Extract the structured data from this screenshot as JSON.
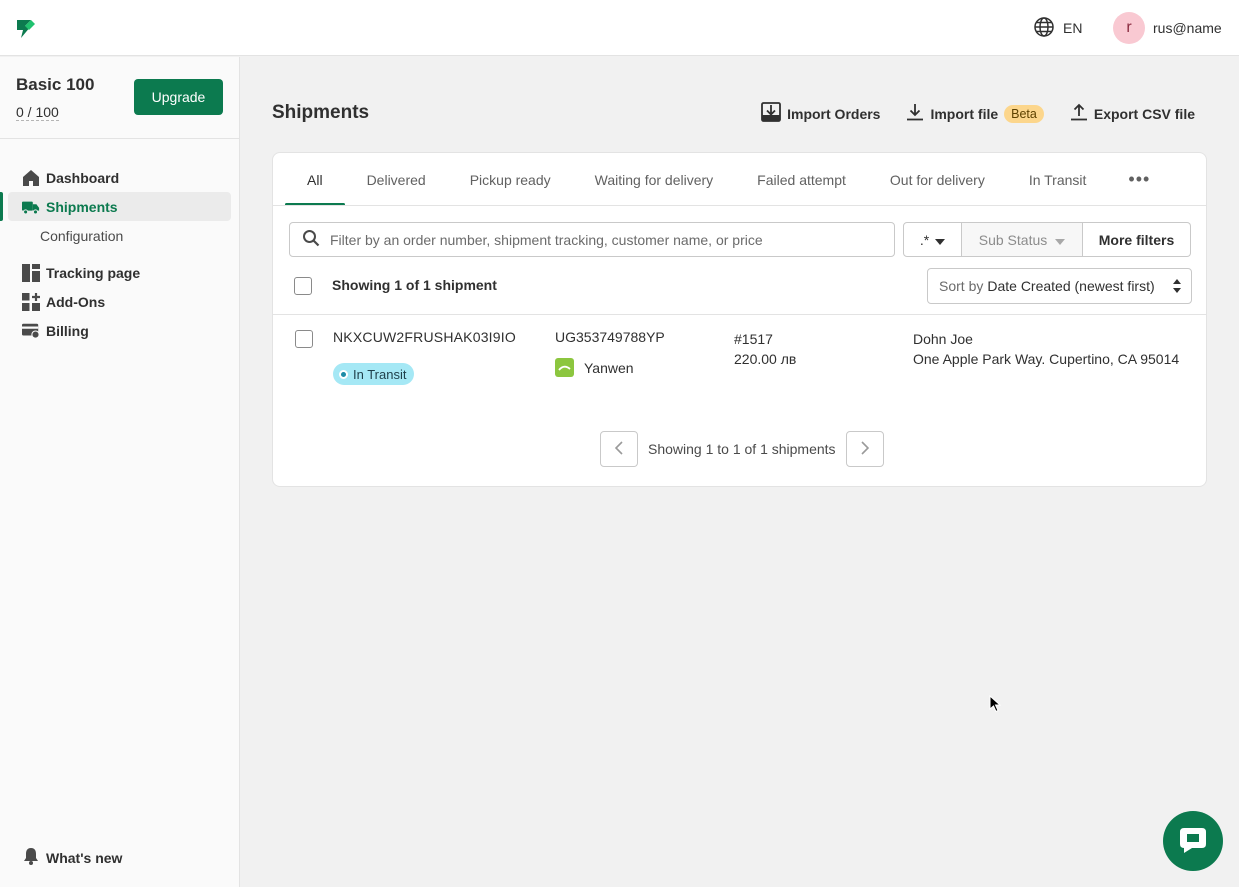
{
  "topbar": {
    "logo_icon": "brand-logo-icon",
    "language": "EN",
    "user_initial": "r",
    "user_name": "rus@name"
  },
  "sidebar": {
    "plan_name": "Basic 100",
    "plan_usage": "0 / 100",
    "upgrade_label": "Upgrade",
    "items": [
      {
        "label": "Dashboard",
        "icon": "home-icon"
      },
      {
        "label": "Shipments",
        "icon": "truck-icon",
        "active": true
      },
      {
        "label": "Configuration",
        "sub": true
      },
      {
        "label": "Tracking page",
        "icon": "layout-icon"
      },
      {
        "label": "Add-Ons",
        "icon": "addons-icon"
      },
      {
        "label": "Billing",
        "icon": "billing-icon"
      }
    ],
    "whats_new": "What's new"
  },
  "main": {
    "title": "Shipments",
    "actions": {
      "import_orders": "Import Orders",
      "import_file": "Import file",
      "beta_badge": "Beta",
      "export_csv": "Export CSV file"
    },
    "tabs": [
      "All",
      "Delivered",
      "Pickup ready",
      "Waiting for delivery",
      "Failed attempt",
      "Out for delivery",
      "In Transit"
    ],
    "tab_more": "•••",
    "search_placeholder": "Filter by an order number, shipment tracking, customer name, or price",
    "filters": {
      "regex": ".*",
      "sub_status": "Sub Status",
      "more": "More filters"
    },
    "showing": "Showing 1 of 1 shipment",
    "sort_by_label": "Sort by",
    "sort_value": "Date Created (newest first)",
    "rows": [
      {
        "id": "NKXCUW2FRUSHAK03I9IO",
        "status": "In Transit",
        "tracking": "UG353749788YP",
        "carrier": "Yanwen",
        "order": "#1517",
        "price": "220.00 лв",
        "customer": "Dohn Joe",
        "address": "One Apple Park Way. Cupertino, CA 95014"
      }
    ],
    "pagination": "Showing 1 to 1 of 1 shipments"
  },
  "colors": {
    "brand": "#0c7a4f",
    "status_in_transit": "#a5e8f5",
    "beta": "#fcd68c",
    "avatar": "#f9c9d2"
  }
}
